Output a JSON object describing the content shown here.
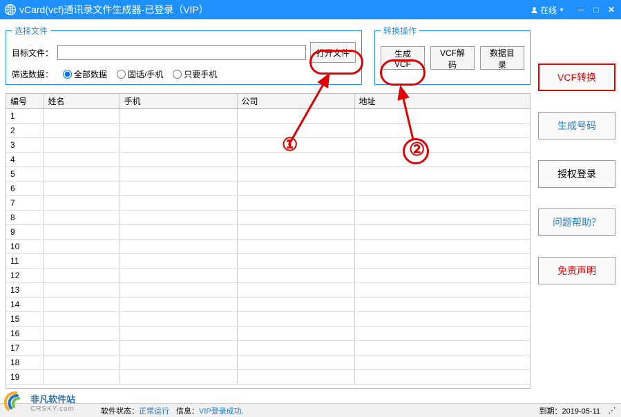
{
  "titlebar": {
    "title": "vCard(vcf)通讯录文件生成器-已登录（VIP）",
    "status": "在线"
  },
  "groups": {
    "select_file": {
      "legend": "选择文件",
      "target_label": "目标文件：",
      "target_value": "",
      "open_btn": "打开文件",
      "filter_label": "筛选数据：",
      "radio_all": "全部数据",
      "radio_landline": "固话/手机",
      "radio_mobile": "只要手机"
    },
    "ops": {
      "legend": "转换操作",
      "gen_btn": "生成VCF",
      "decode_btn": "VCF解码",
      "datadir_btn": "数据目录"
    }
  },
  "sidebar": {
    "vcf_convert": "VCF转换",
    "gen_number": "生成号码",
    "auth_login": "授权登录",
    "help": "问题帮助？",
    "disclaimer": "免责声明"
  },
  "table": {
    "headers": {
      "id": "编号",
      "name": "姓名",
      "phone": "手机",
      "company": "公司",
      "address": "地址"
    },
    "row_count": 19
  },
  "statusbar": {
    "state_label": "软件状态：",
    "state_value": "正常运行",
    "info_label": "信息：",
    "info_value": "VIP登录成功.",
    "date_label": "到期：",
    "date_value": "2019-05-11"
  },
  "annotations": {
    "step1": "①",
    "step2": "②"
  },
  "watermark": {
    "line1": "非凡软件站",
    "line2": "CRSKY.com"
  }
}
